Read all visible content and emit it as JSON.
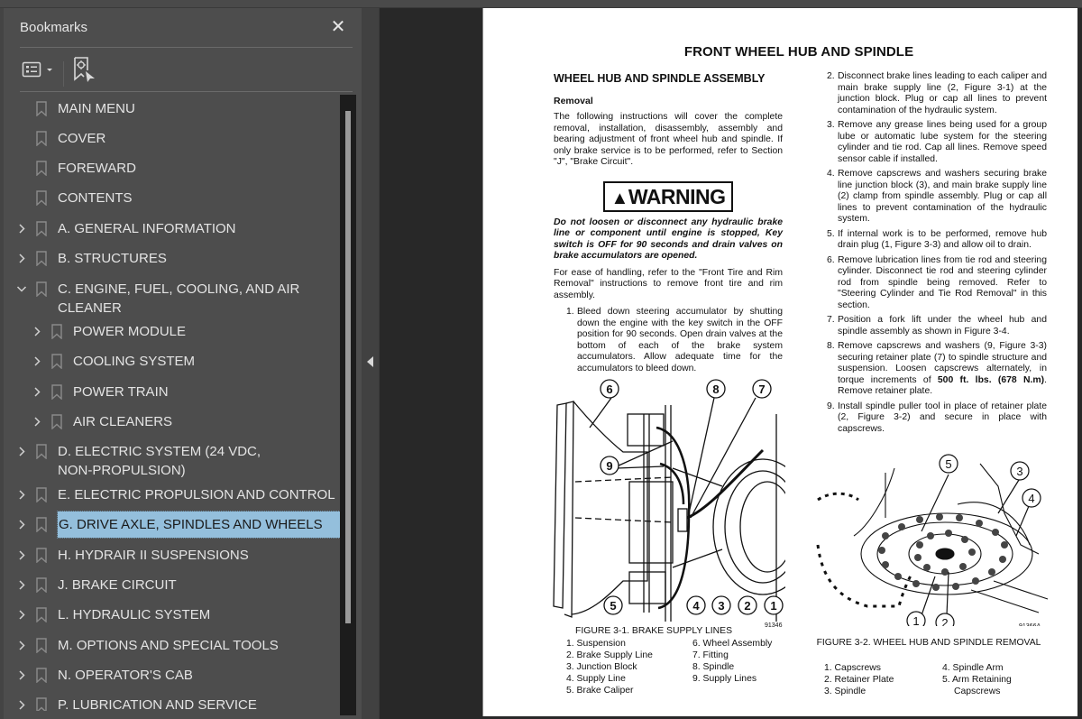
{
  "bookmarks_panel": {
    "title": "Bookmarks",
    "close_icon": "close-icon",
    "toolbar": {
      "options_icon": "list-options-icon",
      "find_icon": "find-current-bookmark-icon"
    },
    "items": [
      {
        "label": "MAIN MENU",
        "level": 0,
        "expander": "none"
      },
      {
        "label": "COVER",
        "level": 0,
        "expander": "none"
      },
      {
        "label": "FOREWARD",
        "level": 0,
        "expander": "none"
      },
      {
        "label": "CONTENTS",
        "level": 0,
        "expander": "none"
      },
      {
        "label": "A. GENERAL INFORMATION",
        "level": 0,
        "expander": "collapsed"
      },
      {
        "label": "B. STRUCTURES",
        "level": 0,
        "expander": "collapsed"
      },
      {
        "label": "C. ENGINE, FUEL, COOLING, AND AIR",
        "label2": "CLEANER",
        "level": 0,
        "expander": "expanded"
      },
      {
        "label": "POWER MODULE",
        "level": 1,
        "expander": "collapsed"
      },
      {
        "label": "COOLING SYSTEM",
        "level": 1,
        "expander": "collapsed"
      },
      {
        "label": "POWER TRAIN",
        "level": 1,
        "expander": "collapsed"
      },
      {
        "label": "AIR CLEANERS",
        "level": 1,
        "expander": "collapsed"
      },
      {
        "label": "D. ELECTRIC SYSTEM (24 VDC,",
        "label2": "NON-PROPULSION)",
        "level": 0,
        "expander": "collapsed"
      },
      {
        "label": "E. ELECTRIC PROPULSION AND CONTROL",
        "level": 0,
        "expander": "collapsed"
      },
      {
        "label": "G. DRIVE AXLE, SPINDLES AND WHEELS",
        "level": 0,
        "expander": "collapsed",
        "selected": true
      },
      {
        "label": "H. HYDRAIR II SUSPENSIONS",
        "level": 0,
        "expander": "collapsed"
      },
      {
        "label": "J. BRAKE CIRCUIT",
        "level": 0,
        "expander": "collapsed"
      },
      {
        "label": "L. HYDRAULIC SYSTEM",
        "level": 0,
        "expander": "collapsed"
      },
      {
        "label": "M. OPTIONS AND SPECIAL TOOLS",
        "level": 0,
        "expander": "collapsed"
      },
      {
        "label": "N. OPERATOR'S CAB",
        "level": 0,
        "expander": "collapsed"
      },
      {
        "label": "P. LUBRICATION AND SERVICE",
        "level": 0,
        "expander": "collapsed"
      }
    ],
    "selection_color": "#94bfdc"
  },
  "document": {
    "page_title": "FRONT WHEEL HUB AND SPINDLE",
    "section_title": "WHEEL HUB AND SPINDLE ASSEMBLY",
    "subsection": "Removal",
    "intro": "The following instructions will cover the complete removal, installation, disassembly, assembly and bearing adjustment of front wheel hub and spindle. If only brake service is to be performed, refer to Section \"J\", \"Brake Circuit\".",
    "warning_label": "WARNING",
    "warning_text": "Do not loosen or disconnect any hydraulic brake line or component until engine is stopped, Key switch is OFF for 90 seconds and drain valves on brake accumulators are opened.",
    "handling_note": "For ease of handling, refer to the \"Front Tire and Rim Removal\" instructions to remove front tire and rim assembly.",
    "steps": [
      {
        "num": "1.",
        "text": "Bleed down steering accumulator by shutting down the engine with the key switch in the OFF position for 90 seconds. Open drain valves at the bottom of each of the brake system accumulators. Allow adequate time for the accumulators to bleed down."
      },
      {
        "num": "2.",
        "text": "Disconnect brake lines leading to each caliper and main brake supply line (2, Figure 3-1) at the junction block. Plug or cap all lines to prevent contamination of the hydraulic system."
      },
      {
        "num": "3.",
        "text": "Remove any grease lines being used for a group lube or automatic lube system for the steering cylinder and tie rod. Cap all lines. Remove speed sensor cable if installed."
      },
      {
        "num": "4.",
        "text": "Remove capscrews and washers securing brake line junction block (3), and main brake supply line (2) clamp from spindle assembly. Plug or cap all lines to prevent contamination of the hydraulic system."
      },
      {
        "num": "5.",
        "text": "If internal work is to be performed, remove hub drain plug (1, Figure 3-3) and allow oil to drain."
      },
      {
        "num": "6.",
        "text": "Remove lubrication lines from tie rod and steering cylinder. Disconnect tie rod and steering cylinder rod from spindle being removed. Refer to \"Steering Cylinder and Tie Rod Removal\" in this section."
      },
      {
        "num": "7.",
        "text": "Position a fork lift under the wheel hub and spindle assembly as shown in Figure 3-4."
      },
      {
        "num": "8.",
        "text_before": "Remove capscrews and washers (9, Figure 3-3) securing retainer plate (7) to spindle structure and suspension. Loosen capscrews alternately, in torque increments of ",
        "text_bold": "500 ft. lbs. (678 N.m)",
        "text_after": ". Remove retainer plate."
      },
      {
        "num": "9.",
        "text": "Install spindle puller tool in place of retainer plate (2, Figure 3-2) and secure in place with capscrews."
      }
    ],
    "figure1": {
      "caption": "FIGURE 3-1. BRAKE SUPPLY LINES",
      "id": "91346",
      "callouts": [
        "6",
        "8",
        "7",
        "9",
        "5",
        "4",
        "3",
        "2",
        "1"
      ],
      "legend_left": [
        "1. Suspension",
        "2. Brake Supply Line",
        "3. Junction Block",
        "4. Supply Line",
        "5. Brake Caliper"
      ],
      "legend_right": [
        "6. Wheel Assembly",
        "7. Fitting",
        "8. Spindle",
        "9. Supply Lines"
      ]
    },
    "figure2": {
      "caption": "FIGURE 3-2. WHEEL HUB AND SPINDLE REMOVAL",
      "id": "91366A",
      "callouts": [
        "5",
        "3",
        "4",
        "1",
        "2"
      ],
      "legend_left": [
        "1. Capscrews",
        "2. Retainer Plate",
        "3. Spindle"
      ],
      "legend_right": [
        "4. Spindle Arm",
        "5. Arm Retaining",
        "Capscrews"
      ]
    }
  }
}
